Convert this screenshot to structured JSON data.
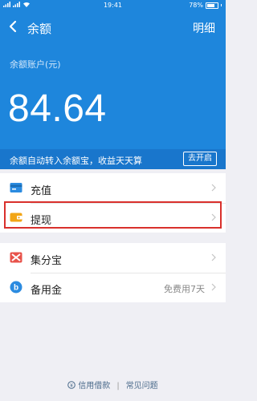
{
  "status_bar": {
    "time": "19:41",
    "battery": "78%"
  },
  "nav": {
    "title": "余额",
    "right_label": "明细"
  },
  "balance": {
    "account_label": "余额账户(元)",
    "amount": "84.64"
  },
  "promo": {
    "text": "余额自动转入余额宝，收益天天算",
    "button": "去开启"
  },
  "section1": [
    {
      "label": "充值",
      "icon": "recharge-card-icon"
    },
    {
      "label": "提现",
      "icon": "wallet-icon"
    }
  ],
  "section2": [
    {
      "label": "集分宝",
      "icon": "jifenbao-icon",
      "hint": ""
    },
    {
      "label": "备用金",
      "icon": "beiyongjin-icon",
      "hint": "免费用7天"
    }
  ],
  "footer": {
    "link1": "信用借款",
    "link2": "常见问题"
  },
  "colors": {
    "primary": "#1e86dc",
    "promo_bg": "#1976cc",
    "highlight": "#d9302c"
  }
}
